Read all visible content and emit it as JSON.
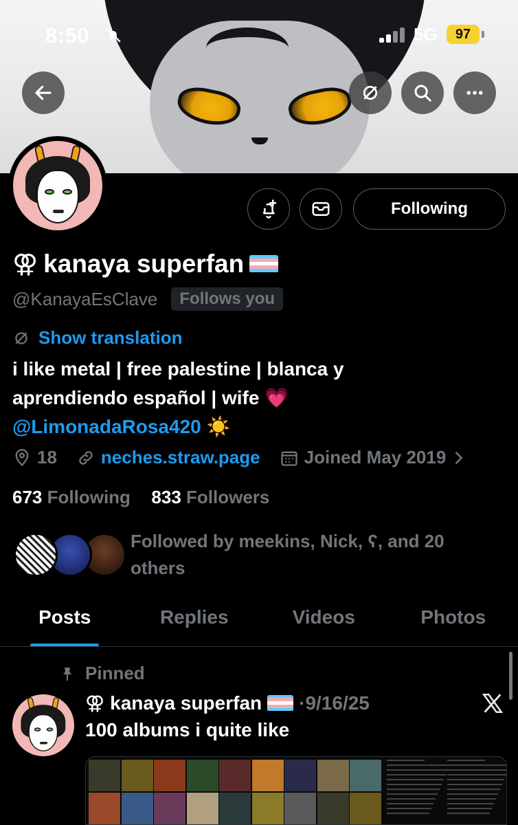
{
  "status_bar": {
    "time": "8:50",
    "network": "5G",
    "battery": "97"
  },
  "profile": {
    "display_name": "kanaya superfan",
    "name_prefix_symbol": "⚢",
    "handle": "@KanayaEsClave",
    "follows_you": "Follows you",
    "translate_label": "Show translation",
    "bio_line1": "i like metal | free palestine | blanca y",
    "bio_line2": "aprendiendo español | wife 💗",
    "bio_mention": "@LimonadaRosa420",
    "bio_emoji": "☀️",
    "location": "18",
    "website": "neches.straw.page",
    "joined": "Joined May 2019",
    "following_count": "673",
    "following_label": "Following",
    "followers_count": "833",
    "followers_label": "Followers",
    "followed_by": "Followed by meekins, Nick, ʕ, and 20 others"
  },
  "actions": {
    "following_button": "Following"
  },
  "icons": {
    "back": "arrow-left-icon",
    "translate_off": "translate-off-icon",
    "search": "search-icon",
    "more": "more-icon",
    "notify": "bell-plus-icon",
    "message": "envelope-icon",
    "location": "location-pin-icon",
    "link": "link-icon",
    "calendar": "calendar-icon",
    "pin": "pin-icon",
    "x": "x-logo-icon",
    "muted": "bell-off-icon"
  },
  "tabs": [
    {
      "label": "Posts",
      "active": true
    },
    {
      "label": "Replies",
      "active": false
    },
    {
      "label": "Videos",
      "active": false
    },
    {
      "label": "Photos",
      "active": false
    }
  ],
  "pinned_post": {
    "pinned_label": "Pinned",
    "author": "kanaya superfan",
    "author_prefix": "⚢",
    "date": "·9/16/25",
    "text": "100 albums i quite like"
  },
  "colors": {
    "accent": "#1d9bf0",
    "muted": "#71767b",
    "background": "#000000",
    "battery": "#f6d230"
  }
}
